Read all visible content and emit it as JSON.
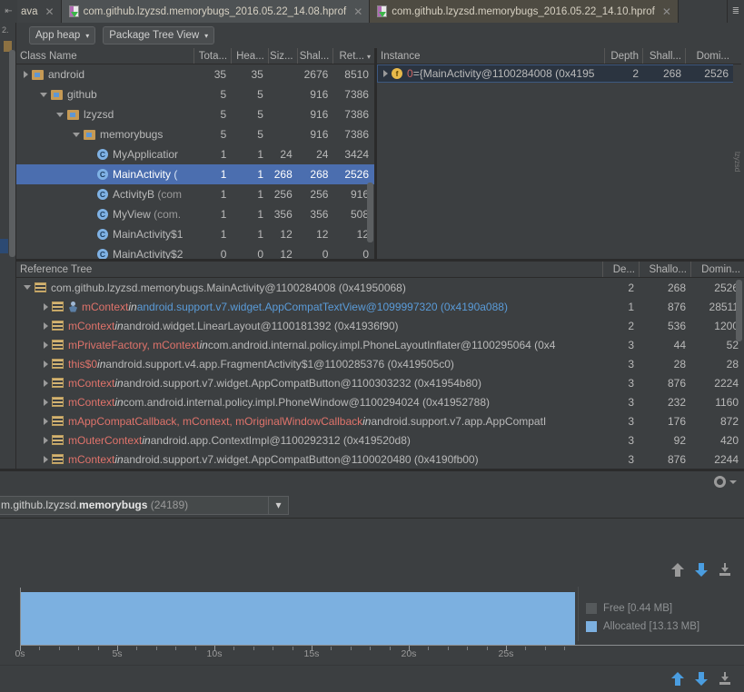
{
  "tabs": {
    "items": [
      {
        "label": "ava",
        "icon": "",
        "active": false,
        "closable": true
      },
      {
        "label": "com.github.lzyzsd.memorybugs_2016.05.22_14.08.hprof",
        "icon": "hprof-file-icon",
        "active": false,
        "closable": true
      },
      {
        "label": "com.github.lzyzsd.memorybugs_2016.05.22_14.10.hprof",
        "icon": "hprof-file-icon",
        "active": true,
        "closable": true
      }
    ],
    "overflow_icon": "tab-list-icon"
  },
  "gutter": {
    "back_icon": "back-arrow-icon",
    "line_number": "2."
  },
  "toolbar": {
    "heap_select": "App heap",
    "view_select": "Package Tree View",
    "caret": "▾"
  },
  "class_tree": {
    "columns": [
      "Class Name",
      "Tota...",
      "Hea...",
      "Siz...",
      "Shal...",
      "Ret..."
    ],
    "sort_caret": "▾",
    "rows": [
      {
        "indent": 0,
        "twisty": "closed",
        "icon": "folder-icon",
        "name": "android",
        "dim": "",
        "total": "35",
        "heap": "35",
        "size": "",
        "shallow": "2676",
        "retained": "8510",
        "selected": false
      },
      {
        "indent": 1,
        "twisty": "open",
        "icon": "folder-icon",
        "name": "github",
        "dim": "",
        "total": "5",
        "heap": "5",
        "size": "",
        "shallow": "916",
        "retained": "7386",
        "selected": false
      },
      {
        "indent": 2,
        "twisty": "open",
        "icon": "folder-icon",
        "name": "lzyzsd",
        "dim": "",
        "total": "5",
        "heap": "5",
        "size": "",
        "shallow": "916",
        "retained": "7386",
        "selected": false
      },
      {
        "indent": 3,
        "twisty": "open",
        "icon": "folder-icon",
        "name": "memorybugs",
        "dim": "",
        "total": "5",
        "heap": "5",
        "size": "",
        "shallow": "916",
        "retained": "7386",
        "selected": false
      },
      {
        "indent": 4,
        "twisty": "none",
        "icon": "class-icon",
        "name": "MyApplicatior",
        "dim": "",
        "total": "1",
        "heap": "1",
        "size": "24",
        "shallow": "24",
        "retained": "3424",
        "selected": false
      },
      {
        "indent": 4,
        "twisty": "none",
        "icon": "class-icon",
        "name": "MainActivity ",
        "dim": "( ",
        "total": "1",
        "heap": "1",
        "size": "268",
        "shallow": "268",
        "retained": "2526",
        "selected": true
      },
      {
        "indent": 4,
        "twisty": "none",
        "icon": "class-icon",
        "name": "ActivityB ",
        "dim": "(com",
        "total": "1",
        "heap": "1",
        "size": "256",
        "shallow": "256",
        "retained": "916",
        "selected": false
      },
      {
        "indent": 4,
        "twisty": "none",
        "icon": "class-icon",
        "name": "MyView ",
        "dim": "(com.",
        "total": "1",
        "heap": "1",
        "size": "356",
        "shallow": "356",
        "retained": "508",
        "selected": false
      },
      {
        "indent": 4,
        "twisty": "none",
        "icon": "class-icon",
        "name": "MainActivity$1",
        "dim": "",
        "total": "1",
        "heap": "1",
        "size": "12",
        "shallow": "12",
        "retained": "12",
        "selected": false
      },
      {
        "indent": 4,
        "twisty": "none",
        "icon": "class-icon",
        "name": "MainActivity$2",
        "dim": "",
        "total": "0",
        "heap": "0",
        "size": "12",
        "shallow": "0",
        "retained": "0",
        "selected": false
      }
    ]
  },
  "instance_panel": {
    "columns": [
      "Instance",
      "Depth",
      "Shall...",
      "Domi..."
    ],
    "side_label": "lzyzsd",
    "rows": [
      {
        "twisty": "closed",
        "icon": "field-icon",
        "index": "0",
        "equals": " = ",
        "value": "{MainActivity@1100284008 (0x4195",
        "depth": "2",
        "shallow": "268",
        "dominating": "2526"
      }
    ]
  },
  "reference_tree": {
    "title": "Reference Tree",
    "columns": [
      "De...",
      "Shallo...",
      "Domin..."
    ],
    "rows": [
      {
        "indent": 0,
        "twisty": "open",
        "icon": "list-icon",
        "person": false,
        "field": "",
        "in": "",
        "klass": "com.github.lzyzsd.memorybugs.MainActivity@1100284008 (0x41950068)",
        "link": false,
        "depth": "2",
        "shallow": "268",
        "dominating": "2526"
      },
      {
        "indent": 1,
        "twisty": "closed",
        "icon": "list-icon",
        "person": true,
        "field": "mContext",
        "in": "in",
        "klass": "android.support.v7.widget.AppCompatTextView@1099997320 (0x4190a088)",
        "link": true,
        "depth": "1",
        "shallow": "876",
        "dominating": "28511"
      },
      {
        "indent": 1,
        "twisty": "closed",
        "icon": "list-icon",
        "person": false,
        "field": "mContext",
        "in": "in",
        "klass": "android.widget.LinearLayout@1100181392 (0x41936f90)",
        "link": false,
        "depth": "2",
        "shallow": "536",
        "dominating": "1200"
      },
      {
        "indent": 1,
        "twisty": "closed",
        "icon": "list-icon",
        "person": false,
        "field": "mPrivateFactory, mContext",
        "in": "in",
        "klass": "com.android.internal.policy.impl.PhoneLayoutInflater@1100295064 (0x4",
        "link": false,
        "depth": "3",
        "shallow": "44",
        "dominating": "52"
      },
      {
        "indent": 1,
        "twisty": "closed",
        "icon": "list-icon",
        "person": false,
        "field": "this$0",
        "in": "in",
        "klass": "android.support.v4.app.FragmentActivity$1@1100285376 (0x419505c0)",
        "link": false,
        "depth": "3",
        "shallow": "28",
        "dominating": "28"
      },
      {
        "indent": 1,
        "twisty": "closed",
        "icon": "list-icon",
        "person": false,
        "field": "mContext",
        "in": "in",
        "klass": "android.support.v7.widget.AppCompatButton@1100303232 (0x41954b80)",
        "link": false,
        "depth": "3",
        "shallow": "876",
        "dominating": "2224"
      },
      {
        "indent": 1,
        "twisty": "closed",
        "icon": "list-icon",
        "person": false,
        "field": "mContext",
        "in": "in",
        "klass": "com.android.internal.policy.impl.PhoneWindow@1100294024 (0x41952788)",
        "link": false,
        "depth": "3",
        "shallow": "232",
        "dominating": "1160"
      },
      {
        "indent": 1,
        "twisty": "closed",
        "icon": "list-icon",
        "person": false,
        "field": "mAppCompatCallback, mContext, mOriginalWindowCallback",
        "in": "in",
        "klass": "android.support.v7.app.AppCompatI",
        "link": false,
        "depth": "3",
        "shallow": "176",
        "dominating": "872"
      },
      {
        "indent": 1,
        "twisty": "closed",
        "icon": "list-icon",
        "person": false,
        "field": "mOuterContext",
        "in": "in",
        "klass": "android.app.ContextImpl@1100292312 (0x419520d8)",
        "link": false,
        "depth": "3",
        "shallow": "92",
        "dominating": "420"
      },
      {
        "indent": 1,
        "twisty": "closed",
        "icon": "list-icon",
        "person": false,
        "field": "mContext",
        "in": "in",
        "klass": "android.support.v7.widget.AppCompatButton@1100020480 (0x4190fb00)",
        "link": false,
        "depth": "3",
        "shallow": "876",
        "dominating": "2244"
      }
    ]
  },
  "monitor": {
    "settings_icon": "gear-icon",
    "settings_caret": "▾",
    "process_prefix": "m.github.lzyzsd.",
    "process_bold": "memorybugs",
    "process_count": "(24189)",
    "process_caret": "▾",
    "actions_top": [
      {
        "icon": "initiate-gc-up-icon",
        "color": "#9a9a9a"
      },
      {
        "icon": "dump-java-heap-down-icon",
        "color": "#4a9de0"
      },
      {
        "icon": "start-allocation-tracking-icon",
        "color": "#9a9a9a"
      }
    ],
    "actions_bottom": [
      {
        "icon": "initiate-gc-up-icon",
        "color": "#4a9de0"
      },
      {
        "icon": "dump-java-heap-down-icon",
        "color": "#4a9de0"
      },
      {
        "icon": "start-allocation-tracking-icon",
        "color": "#9a9a9a"
      }
    ]
  },
  "chart_data": {
    "type": "area",
    "title": "",
    "xlabel": "",
    "ylabel": "",
    "xlim": [
      0,
      28.6
    ],
    "ylim": [
      0,
      13.57
    ],
    "grid": false,
    "legend_position": "right",
    "tick_labels": [
      "0s",
      "5s",
      "10s",
      "15s",
      "20s",
      "25s"
    ],
    "tick_values": [
      0,
      5,
      10,
      15,
      20,
      25
    ],
    "series": [
      {
        "name": "Free [0.44 MB]",
        "color": "#55595b",
        "value_mb": 0.44,
        "x": [
          0,
          2,
          4,
          6,
          8,
          10,
          12,
          14,
          16,
          18,
          20,
          22,
          24,
          26,
          28
        ],
        "values": [
          0.44,
          0.44,
          0.44,
          0.44,
          0.44,
          0.44,
          0.44,
          0.44,
          0.44,
          0.44,
          0.44,
          0.44,
          0.44,
          0.44,
          0.44
        ]
      },
      {
        "name": "Allocated [13.13 MB]",
        "color": "#7cb0e0",
        "value_mb": 13.13,
        "x": [
          0,
          2,
          4,
          6,
          8,
          10,
          12,
          14,
          16,
          18,
          20,
          22,
          24,
          26,
          28
        ],
        "values": [
          13.13,
          13.13,
          13.13,
          13.13,
          13.13,
          13.13,
          13.13,
          13.13,
          13.13,
          13.13,
          13.13,
          13.13,
          13.13,
          13.13,
          13.13
        ]
      }
    ]
  },
  "colors": {
    "background": "#3c3f41",
    "selection": "#4b6eaf",
    "field_red": "#e0736b",
    "link_blue": "#5a9bd8",
    "chart_blue": "#7cb0e0",
    "folder_gold": "#c69a55"
  }
}
